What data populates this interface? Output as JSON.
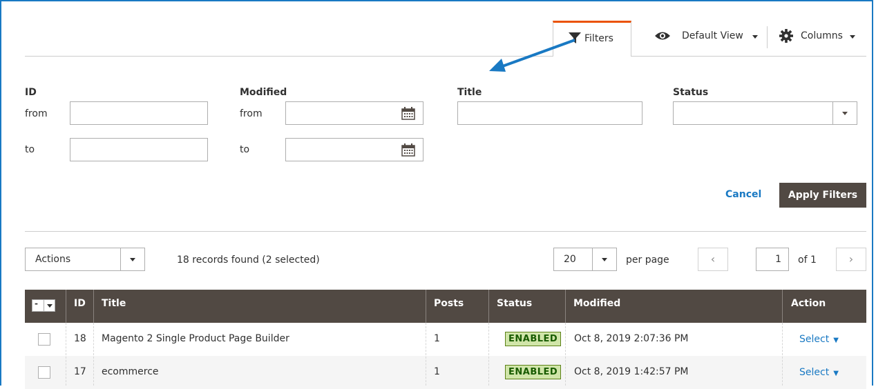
{
  "toolbar": {
    "filters_label": "Filters",
    "default_view_label": "Default View",
    "columns_label": "Columns"
  },
  "filters": {
    "id_label": "ID",
    "modified_label": "Modified",
    "title_label": "Title",
    "status_label": "Status",
    "from_label": "from",
    "to_label": "to",
    "cancel_label": "Cancel",
    "apply_label": "Apply Filters"
  },
  "grid": {
    "actions_label": "Actions",
    "records_text": "18 records found (2 selected)",
    "per_page_value": "20",
    "per_page_label": "per page",
    "page_value": "1",
    "page_of": "of 1",
    "mass_select_label": "-",
    "columns": [
      "ID",
      "Title",
      "Posts",
      "Status",
      "Modified",
      "Action"
    ],
    "rows": [
      {
        "id": "18",
        "title": "Magento 2 Single Product Page Builder",
        "posts": "1",
        "status": "ENABLED",
        "modified": "Oct 8, 2019 2:07:36 PM",
        "action": "Select"
      },
      {
        "id": "17",
        "title": "ecommerce",
        "posts": "1",
        "status": "ENABLED",
        "modified": "Oct 8, 2019 1:42:57 PM",
        "action": "Select"
      }
    ]
  },
  "colors": {
    "accent": "#eb5202",
    "header_bg": "#514943",
    "link": "#1979c3",
    "annotation_arrow": "#1979c3"
  }
}
